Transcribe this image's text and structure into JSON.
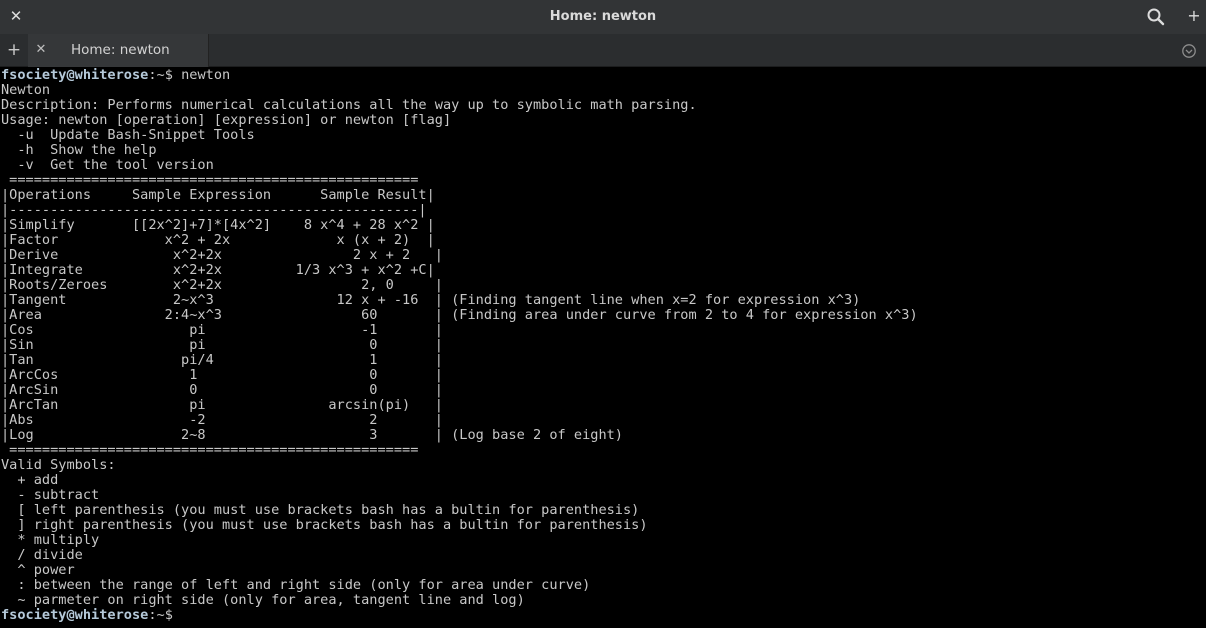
{
  "window": {
    "title": "Home: newton",
    "tab_label": "Home: newton"
  },
  "icons": {
    "close": "✕",
    "new_tab": "+",
    "add": "+",
    "tab_close": "✕"
  },
  "colors": {
    "titlebar_bg": "#323436",
    "terminal_bg": "#000000",
    "terminal_fg": "#c8c8c8",
    "prompt_user": "#b5c9d9"
  },
  "terminal": {
    "prompt_user": "fsociety@whiterose",
    "prompt_path": ":~$ ",
    "command": "newton",
    "output_lines": [
      "Newton",
      "Description: Performs numerical calculations all the way up to symbolic math parsing.",
      "Usage: newton [operation] [expression] or newton [flag]",
      "  -u  Update Bash-Snippet Tools",
      "  -h  Show the help",
      "  -v  Get the tool version",
      " ==================================================",
      "|Operations     Sample Expression      Sample Result|",
      "|--------------------------------------------------|",
      "|Simplify       [[2x^2]+7]*[4x^2]    8 x^4 + 28 x^2 |",
      "|Factor             x^2 + 2x             x (x + 2)  |",
      "|Derive              x^2+2x                2 x + 2   |",
      "|Integrate           x^2+2x         1/3 x^3 + x^2 +C|",
      "|Roots/Zeroes        x^2+2x                 2, 0     |",
      "|Tangent             2~x^3               12 x + -16  | (Finding tangent line when x=2 for expression x^3)",
      "|Area               2:4~x^3                 60       | (Finding area under curve from 2 to 4 for expression x^3)",
      "|Cos                   pi                   -1       |",
      "|Sin                   pi                    0       |",
      "|Tan                  pi/4                   1       |",
      "|ArcCos                1                     0       |",
      "|ArcSin                0                     0       |",
      "|ArcTan                pi               arcsin(pi)   |",
      "|Abs                   -2                    2       |",
      "|Log                  2~8                    3       | (Log base 2 of eight)",
      " ==================================================",
      "Valid Symbols:",
      "  + add",
      "  - subtract",
      "  [ left parenthesis (you must use brackets bash has a bultin for parenthesis)",
      "  ] right parenthesis (you must use brackets bash has a bultin for parenthesis)",
      "  * multiply",
      "  / divide",
      "  ^ power",
      "  : between the range of left and right side (only for area under curve)",
      "  ~ parmeter on right side (only for area, tangent line and log)"
    ]
  }
}
